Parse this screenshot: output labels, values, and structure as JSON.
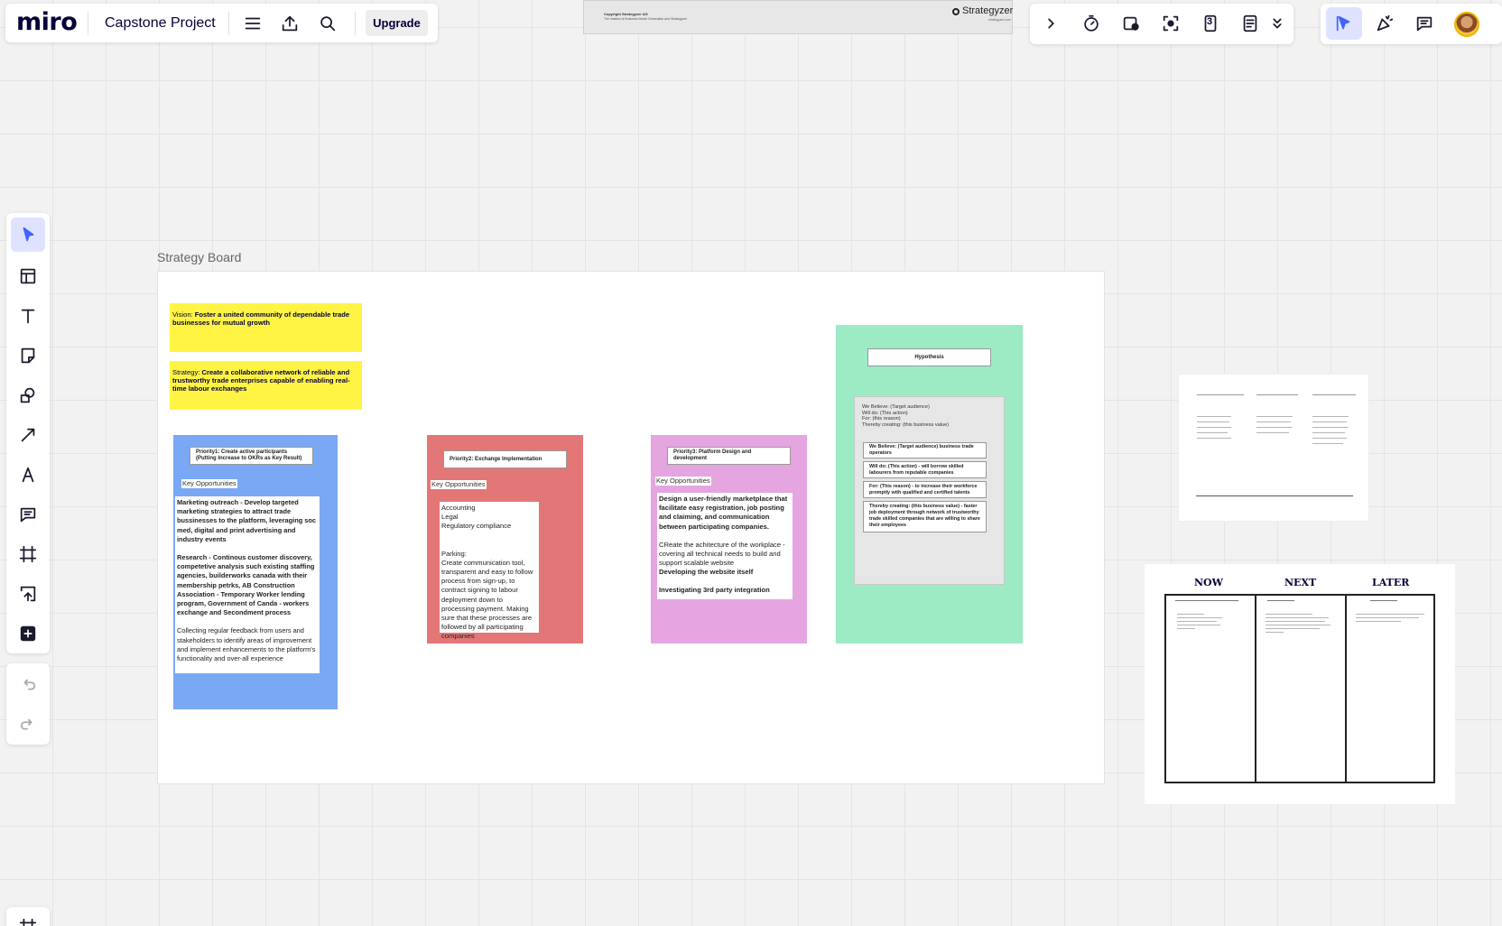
{
  "topbar": {
    "logo": "miro",
    "board_name": "Capstone Project",
    "upgrade_label": "Upgrade",
    "icons": [
      "menu-icon",
      "export-icon",
      "search-icon"
    ]
  },
  "right_toolbar": {
    "icons": [
      "chevron-right-icon",
      "timer-icon",
      "voting-icon",
      "focus-icon",
      "calendar-icon",
      "notes-icon",
      "chevron-double-down-icon"
    ],
    "calendar_number": "3",
    "collab_icons": [
      "cursor-follow-icon",
      "celebrate-icon",
      "comment-icon"
    ]
  },
  "top_image": {
    "line1": "Copyright Strategyzer AG",
    "line2": "The makers of Business Model Generation and Strategyzer",
    "brand": "Strategyzer",
    "brand_sub": "strategyzer.com"
  },
  "left_toolbar": {
    "tools": [
      "select-tool",
      "templates-tool",
      "text-tool",
      "sticky-note-tool",
      "shapes-tool",
      "connection-line-tool",
      "pen-tool",
      "comment-tool",
      "frame-tool",
      "upload-tool",
      "more-apps-tool",
      "undo-tool",
      "redo-tool"
    ]
  },
  "frame": {
    "title": "Strategy Board"
  },
  "vision": {
    "label": "Vision:",
    "text": "Foster a united community of dependable trade businesses for mutual growth"
  },
  "strategy": {
    "label": "Strategy:",
    "text": "Create a collaborative network of reliable and trustworthy trade enterprises capable of enabling real-time labour exchanges"
  },
  "priority1": {
    "title": "Priority1: Create active participants (Putting Increase to OKRs as Key Result)",
    "tag": "Key Opportunities",
    "p1": "Marketing outreach - Develop targeted marketing strategies to attract trade bussinesses to the platform, leveraging soc med, digital and print advertising and industry events",
    "p2": "Research - Continous customer discovery, competetive analysis such existing staffing agencies, builderworks canada with their membership petrks, AB Construction Association - Temporary Worker lending program, Government of Canda - workers exchange and Secondment process",
    "p3": "Collecting regular feedback from users and stakeholders to identify areas of improvement and implement enhancements to the platform's functionality and over-all experience"
  },
  "priority2": {
    "title": "Priority2: Exchange Implementation",
    "tag": "Key Opportunities",
    "lines": [
      "Accounting",
      "Legal",
      "Regulatory compliance"
    ],
    "parking": "Parking:",
    "parking_text": "Create communication tool, transparent and easy to follow process from sign-up, to contract signing to labour deployment down to processing payment. Making sure that these processes are followed by all participating companies"
  },
  "priority3": {
    "title": "Priority3: Platform Design and development",
    "tag": "Key Opportunities",
    "p1": "Design a user-friendly marketplace that facilitate easy registration, job posting and claiming, and communication between participating companies.",
    "p2": "CReate the achitecture of the workplace - covering all technical needs to build and support scalable website",
    "p3": "Developing the website itself",
    "p4": "Investigating 3rd party integration"
  },
  "hypothesis": {
    "title": "Hypothesis",
    "template_lines": [
      "We Believe: (Target audience)",
      "Will do: (This action)",
      "For: (this reason)",
      "Thereby creating: (this business value)"
    ],
    "rows": [
      "We Believe: (Target audience) business trade operators",
      "Will do: (This action) - will borrow skilled labourers from reputable companies",
      "For: (This reason) - to increase their workforce promptly with qualified and certified talents",
      "Thereby creating: (this business value) - faster job deployment through network of trustworthy trade skilled companies that are willing to share their employees"
    ]
  },
  "roadmap": {
    "columns": [
      "NOW",
      "NEXT",
      "LATER"
    ]
  },
  "colors": {
    "yellow": "#fff444",
    "blue": "#7aa8f5",
    "red": "#e37777",
    "pink": "#e5a5e0",
    "green": "#9debc5",
    "accent": "#4262ff"
  }
}
